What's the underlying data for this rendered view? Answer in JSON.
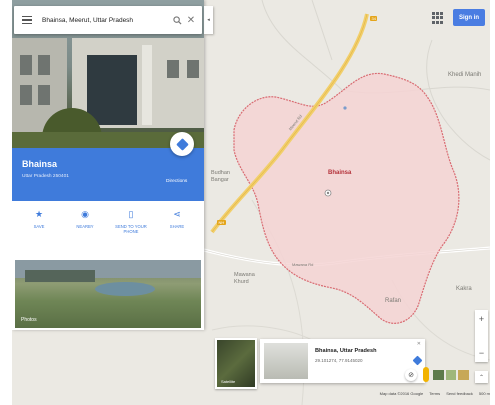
{
  "search": {
    "query": "Bhainsa, Meerut, Uttar Pradesh"
  },
  "header": {
    "signin_label": "Sign in"
  },
  "place": {
    "name": "Bhainsa",
    "subtitle": "Uttar Pradesh 250401",
    "directions_label": "Directions"
  },
  "actions": [
    {
      "label": "SAVE",
      "icon": "star-icon"
    },
    {
      "label": "NEARBY",
      "icon": "nearby-icon"
    },
    {
      "label": "SEND TO YOUR PHONE",
      "icon": "phone-icon"
    },
    {
      "label": "SHARE",
      "icon": "share-icon"
    }
  ],
  "photos": {
    "label": "Photos"
  },
  "map": {
    "boundary_label": "Bhainsa",
    "labels": {
      "budhan": "Budhan",
      "bangar": "Bangar",
      "mawana": "Mawana",
      "khurd": "Khurd",
      "rafan": "Rafan",
      "kakra": "Kakra",
      "khedi": "Khedi Manih",
      "road1": "Meerut Rd",
      "road2": "Mawana Rd",
      "hwy1": "NH",
      "hwy2": "34"
    }
  },
  "satellite": {
    "label": "Satellite"
  },
  "info_card": {
    "title": "Bhainsa, Uttar Pradesh",
    "coords": "29.101274, 77.9145020"
  },
  "footer": {
    "mapdata": "Map data ©2016 Google",
    "terms": "Terms",
    "feedback": "Send feedback",
    "scale": "500 m"
  },
  "colors": {
    "accent_blue": "#3f7bdb",
    "boundary_fill": "#f4d3d3",
    "boundary_stroke": "#d96b72",
    "highway": "#f1cf6b"
  }
}
